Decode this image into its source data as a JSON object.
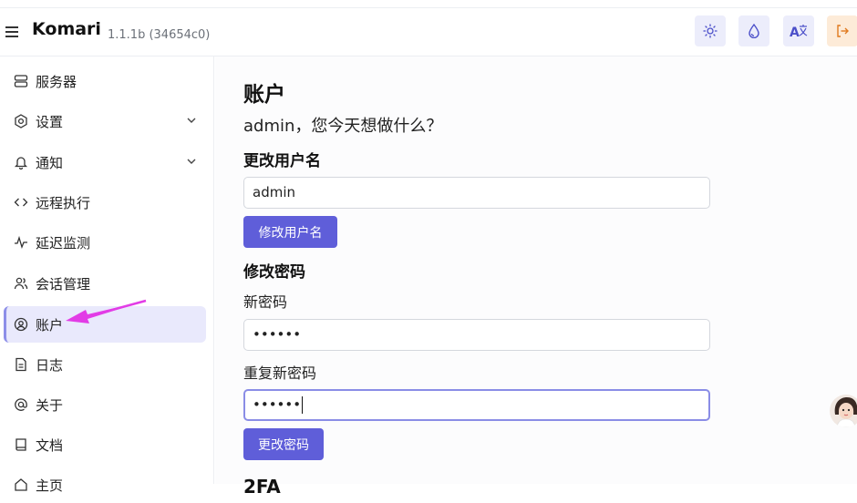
{
  "app": {
    "name": "Komari",
    "version": "1.1.1b (34654c0)"
  },
  "topbar": {
    "buttons": [
      {
        "icon": "sun-icon",
        "color": "#ecedfb"
      },
      {
        "icon": "droplet-icon",
        "color": "#ecedfb"
      },
      {
        "icon": "translate-icon",
        "color": "#ecedfb"
      },
      {
        "icon": "logout-icon",
        "color": "#fdebd8"
      }
    ]
  },
  "sidebar": {
    "items": [
      {
        "label": "服务器",
        "icon": "server-icon"
      },
      {
        "label": "设置",
        "icon": "settings-icon",
        "expandable": true
      },
      {
        "label": "通知",
        "icon": "bell-icon",
        "expandable": true
      },
      {
        "label": "远程执行",
        "icon": "code-icon"
      },
      {
        "label": "延迟监测",
        "icon": "activity-icon"
      },
      {
        "label": "会话管理",
        "icon": "users-icon"
      },
      {
        "label": "账户",
        "icon": "user-circle-icon",
        "active": true
      },
      {
        "label": "日志",
        "icon": "file-icon"
      },
      {
        "label": "关于",
        "icon": "at-icon"
      },
      {
        "label": "文档",
        "icon": "book-icon"
      },
      {
        "label": "主页",
        "icon": "home-icon"
      }
    ]
  },
  "main": {
    "title": "账户",
    "greeting": "admin，您今天想做什么？",
    "username_section": {
      "heading": "更改用户名",
      "value": "admin",
      "button": "修改用户名"
    },
    "password_section": {
      "heading": "修改密码",
      "new_label": "新密码",
      "new_value": "••••••",
      "repeat_label": "重复新密码",
      "repeat_value": "••••••",
      "button": "更改密码"
    },
    "next_section_heading": "2FA"
  },
  "colors": {
    "accent": "#5f5ed9",
    "active_bg": "#e9e9fc",
    "annotation_arrow": "#e23ce6"
  }
}
